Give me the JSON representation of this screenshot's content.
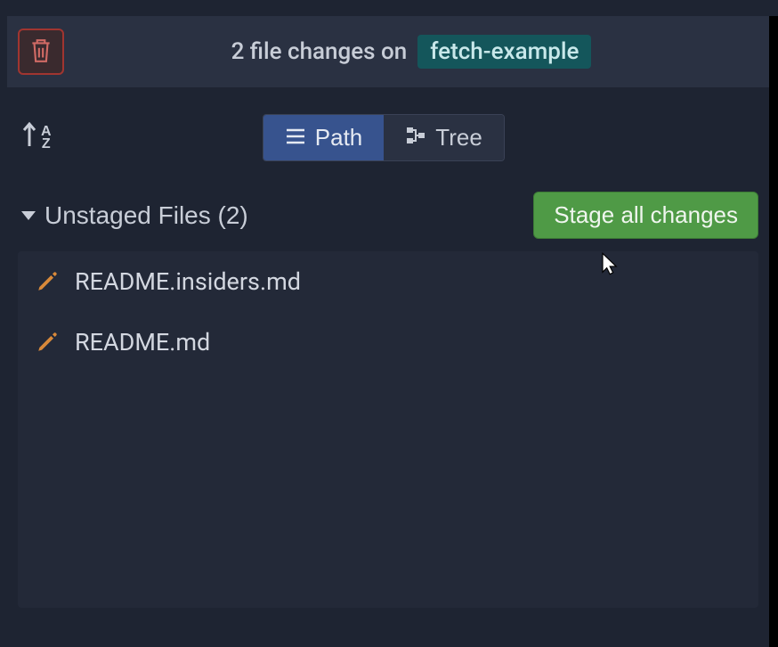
{
  "header": {
    "changes_prefix": "2 file changes on",
    "branch": "fetch-example"
  },
  "toolbar": {
    "sort_a": "A",
    "sort_z": "Z",
    "path_label": "Path",
    "tree_label": "Tree"
  },
  "section": {
    "title": "Unstaged Files (2)",
    "stage_all_label": "Stage all changes"
  },
  "files": [
    {
      "name": "README.insiders.md"
    },
    {
      "name": "README.md"
    }
  ],
  "icons": {
    "trash": "trash",
    "sort": "sort-az",
    "hamburger": "hamburger",
    "tree": "tree",
    "caret": "caret-down",
    "pencil": "pencil"
  }
}
